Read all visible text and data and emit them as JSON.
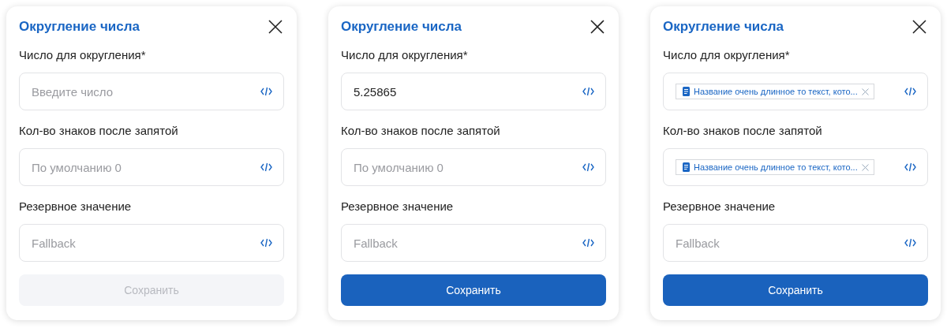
{
  "dialogs": [
    {
      "title": "Округление числа",
      "fields": [
        {
          "label": "Число для округления*",
          "kind": "empty",
          "placeholder": "Введите число"
        },
        {
          "label": "Кол-во знаков после запятой",
          "kind": "empty",
          "placeholder": "По умолчанию 0"
        },
        {
          "label": "Резервное значение",
          "kind": "empty",
          "placeholder": "Fallback"
        }
      ],
      "save": {
        "label": "Сохранить",
        "disabled": true
      }
    },
    {
      "title": "Округление числа",
      "fields": [
        {
          "label": "Число для округления*",
          "kind": "value",
          "value": "5.25865"
        },
        {
          "label": "Кол-во знаков после запятой",
          "kind": "empty",
          "placeholder": "По умолчанию 0"
        },
        {
          "label": "Резервное значение",
          "kind": "empty",
          "placeholder": "Fallback"
        }
      ],
      "save": {
        "label": "Сохранить",
        "disabled": false
      }
    },
    {
      "title": "Округление числа",
      "fields": [
        {
          "label": "Число для округления*",
          "kind": "chip",
          "chip": "Название очень длинное то текст, кото..."
        },
        {
          "label": "Кол-во знаков после запятой",
          "kind": "chip",
          "chip": "Название очень длинное то текст, кото..."
        },
        {
          "label": "Резервное значение",
          "kind": "empty",
          "placeholder": "Fallback"
        }
      ],
      "save": {
        "label": "Сохранить",
        "disabled": false
      }
    }
  ]
}
